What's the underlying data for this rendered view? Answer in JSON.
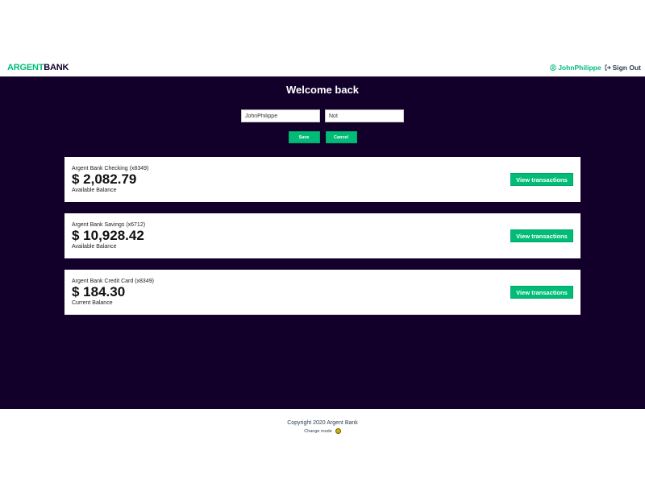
{
  "nav": {
    "logo_primary": "ARGENT",
    "logo_secondary": "BANK",
    "user_name": "JohnPhilippe",
    "sign_out": "Sign Out",
    "user_icon": "user-circle-icon",
    "sign_out_icon": "sign-out-icon"
  },
  "header": {
    "welcome": "Welcome back"
  },
  "edit_form": {
    "first_name_value": "JohnPhilippe",
    "last_name_value": "Not",
    "save_label": "Save",
    "cancel_label": "Cancel"
  },
  "accounts": [
    {
      "title": "Argent Bank Checking (x8349)",
      "amount": "$ 2,082.79",
      "description": "Available Balance",
      "button": "View transactions"
    },
    {
      "title": "Argent Bank Savings (x6712)",
      "amount": "$ 10,928.42",
      "description": "Available Balance",
      "button": "View transactions"
    },
    {
      "title": "Argent Bank Credit Card (x8349)",
      "amount": "$ 184.30",
      "description": "Current Balance",
      "button": "View transactions"
    }
  ],
  "footer": {
    "copyright": "Copyright 2020 Argent Bank",
    "change_mode": "Change mode"
  },
  "colors": {
    "accent": "#00bc77",
    "main_bg": "#12002b",
    "mode_toggle": "#d4b000"
  }
}
